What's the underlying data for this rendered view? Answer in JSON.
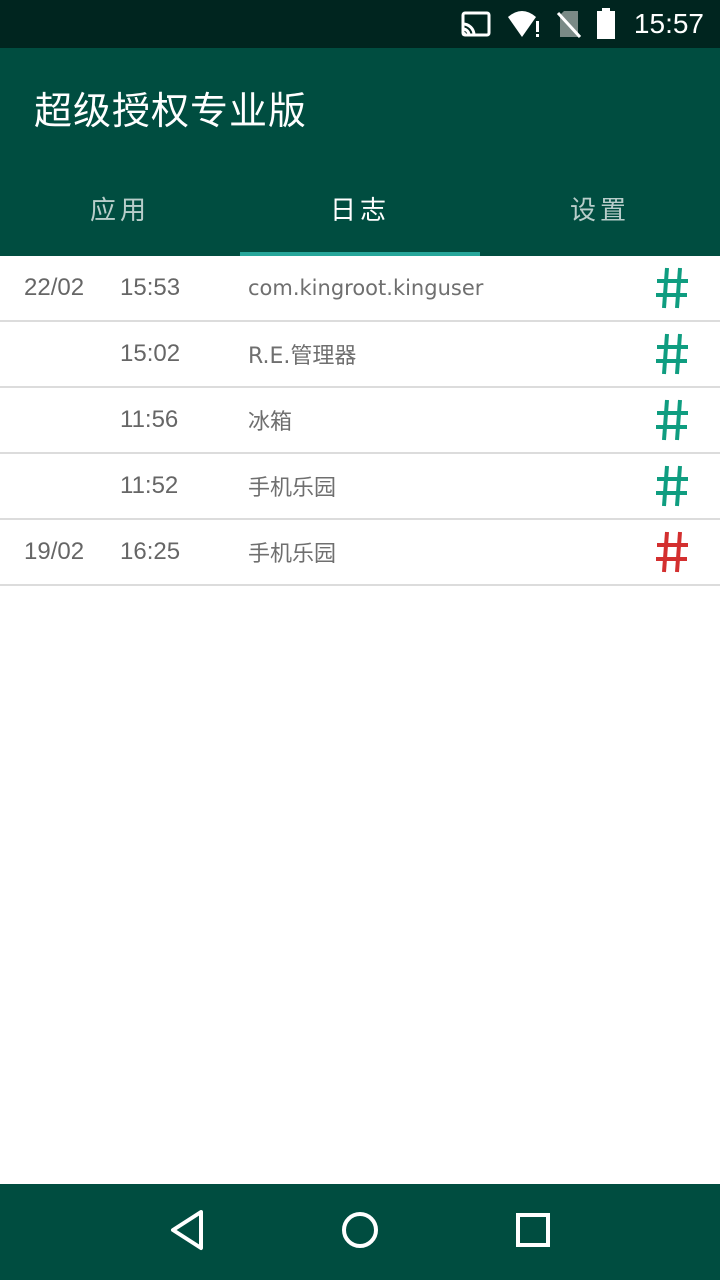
{
  "status_bar": {
    "time": "15:57",
    "icons": [
      "cast-icon",
      "wifi-alert-icon",
      "no-sim-icon",
      "battery-icon"
    ]
  },
  "app": {
    "title": "超级授权专业版"
  },
  "tabs": [
    {
      "label": "应用",
      "active": false
    },
    {
      "label": "日志",
      "active": true
    },
    {
      "label": "设置",
      "active": false
    }
  ],
  "log": [
    {
      "date": "22/02",
      "time": "15:53",
      "app": "com.kingroot.kinguser",
      "status": "granted"
    },
    {
      "date": "",
      "time": "15:02",
      "app": "R.E.管理器",
      "status": "granted"
    },
    {
      "date": "",
      "time": "11:56",
      "app": "冰箱",
      "status": "granted"
    },
    {
      "date": "",
      "time": "11:52",
      "app": "手机乐园",
      "status": "granted"
    },
    {
      "date": "19/02",
      "time": "16:25",
      "app": "手机乐园",
      "status": "denied"
    }
  ],
  "colors": {
    "primary": "#004d40",
    "status_bar": "#00251f",
    "accent": "#26a69a",
    "granted": "#0f9d80",
    "denied": "#d32f2f"
  },
  "nav_bar": {
    "icons": [
      "back-icon",
      "home-icon",
      "recents-icon"
    ]
  }
}
